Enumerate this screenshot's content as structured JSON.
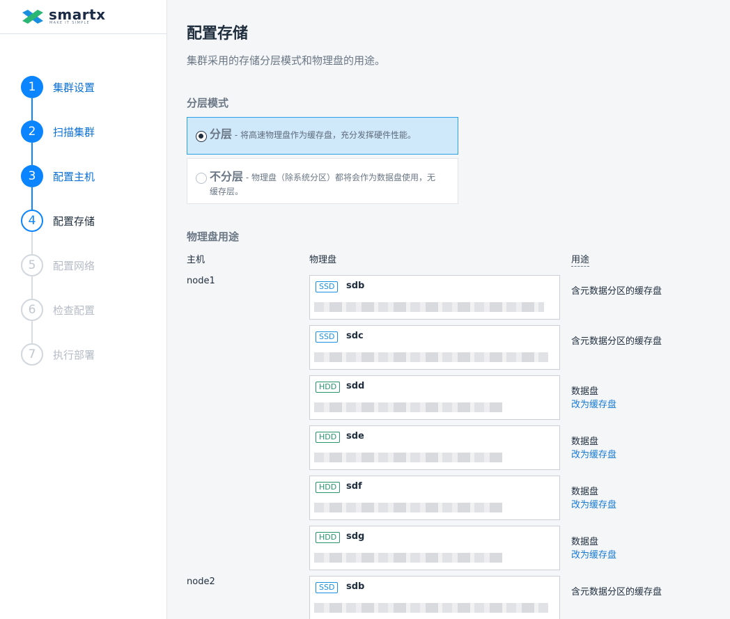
{
  "brand": {
    "name": "smartx",
    "tagline": "MAKE IT SIMPLE"
  },
  "steps": [
    {
      "number": "1",
      "label": "集群设置",
      "state": "done"
    },
    {
      "number": "2",
      "label": "扫描集群",
      "state": "done"
    },
    {
      "number": "3",
      "label": "配置主机",
      "state": "done"
    },
    {
      "number": "4",
      "label": "配置存储",
      "state": "active"
    },
    {
      "number": "5",
      "label": "配置网络",
      "state": "todo"
    },
    {
      "number": "6",
      "label": "检查配置",
      "state": "todo"
    },
    {
      "number": "7",
      "label": "执行部署",
      "state": "todo"
    }
  ],
  "page": {
    "title": "配置存储",
    "description": "集群采用的存储分层模式和物理盘的用途。"
  },
  "tier_mode": {
    "section_title": "分层模式",
    "options": [
      {
        "name": "分层",
        "desc": " - 将高速物理盘作为缓存盘，充分发挥硬件性能。",
        "selected": true
      },
      {
        "name": "不分层",
        "desc": " - 物理盘（除系统分区）都将会作为数据盘使用，无缓存层。",
        "selected": false
      }
    ]
  },
  "disk_usage": {
    "section_title": "物理盘用途",
    "col_host": "主机",
    "col_disk": "物理盘",
    "col_usage": "用途",
    "hosts": [
      {
        "name": "node1",
        "disks": [
          {
            "type": "SSD",
            "name": "sdb",
            "usage": "含元数据分区的缓存盘",
            "action": ""
          },
          {
            "type": "SSD",
            "name": "sdc",
            "usage": "含元数据分区的缓存盘",
            "action": ""
          },
          {
            "type": "HDD",
            "name": "sdd",
            "usage": "数据盘",
            "action": "改为缓存盘"
          },
          {
            "type": "HDD",
            "name": "sde",
            "usage": "数据盘",
            "action": "改为缓存盘"
          },
          {
            "type": "HDD",
            "name": "sdf",
            "usage": "数据盘",
            "action": "改为缓存盘"
          },
          {
            "type": "HDD",
            "name": "sdg",
            "usage": "数据盘",
            "action": "改为缓存盘"
          }
        ]
      },
      {
        "name": "node2",
        "disks": [
          {
            "type": "SSD",
            "name": "sdb",
            "usage": "含元数据分区的缓存盘",
            "action": ""
          }
        ]
      }
    ]
  },
  "colors": {
    "accent": "#0a84ff",
    "selected_bg": "#cfe9fb",
    "ssd": "#1a8fe0",
    "hdd": "#27956a",
    "link": "#1679d6"
  }
}
